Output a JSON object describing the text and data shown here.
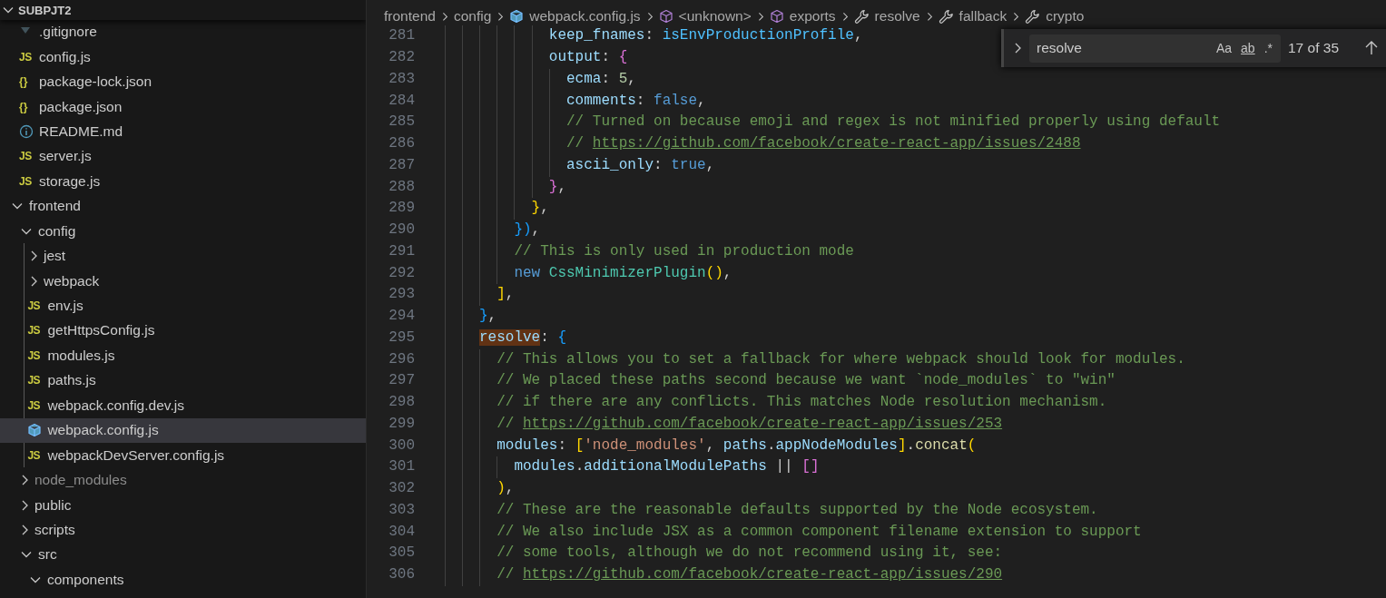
{
  "explorer": {
    "title": "SUBPJT2",
    "expanded": true,
    "items": [
      {
        "kind": "gitignore",
        "label": ".gitignore",
        "selected": false,
        "ignored": false
      },
      {
        "kind": "js",
        "icon": "JS",
        "label": "config.js",
        "selected": false,
        "ignored": false
      },
      {
        "kind": "json",
        "icon": "{}",
        "label": "package-lock.json",
        "selected": false,
        "ignored": false
      },
      {
        "kind": "json",
        "icon": "{}",
        "label": "package.json",
        "selected": false,
        "ignored": false
      },
      {
        "kind": "info",
        "label": "README.md",
        "selected": false,
        "ignored": false
      },
      {
        "kind": "js",
        "icon": "JS",
        "label": "server.js",
        "selected": false,
        "ignored": false
      },
      {
        "kind": "js",
        "icon": "JS",
        "label": "storage.js",
        "selected": false,
        "ignored": false
      },
      {
        "kind": "folder",
        "label": "frontend",
        "expanded": true,
        "selected": false,
        "ignored": false,
        "children": [
          {
            "kind": "folder",
            "label": "config",
            "expanded": true,
            "selected": false,
            "ignored": false,
            "children": [
              {
                "kind": "folder",
                "label": "jest",
                "expanded": false,
                "selected": false,
                "ignored": false
              },
              {
                "kind": "folder",
                "label": "webpack",
                "expanded": false,
                "selected": false,
                "ignored": false
              },
              {
                "kind": "js",
                "icon": "JS",
                "label": "env.js",
                "selected": false,
                "ignored": false
              },
              {
                "kind": "js",
                "icon": "JS",
                "label": "getHttpsConfig.js",
                "selected": false,
                "ignored": false
              },
              {
                "kind": "js",
                "icon": "JS",
                "label": "modules.js",
                "selected": false,
                "ignored": false
              },
              {
                "kind": "js",
                "icon": "JS",
                "label": "paths.js",
                "selected": false,
                "ignored": false
              },
              {
                "kind": "js",
                "icon": "JS",
                "label": "webpack.config.dev.js",
                "selected": false,
                "ignored": false
              },
              {
                "kind": "webpack",
                "label": "webpack.config.js",
                "selected": true,
                "ignored": false
              },
              {
                "kind": "js",
                "icon": "JS",
                "label": "webpackDevServer.config.js",
                "selected": false,
                "ignored": false
              }
            ]
          },
          {
            "kind": "folder",
            "label": "node_modules",
            "expanded": false,
            "selected": false,
            "ignored": true
          },
          {
            "kind": "folder",
            "label": "public",
            "expanded": false,
            "selected": false,
            "ignored": false
          },
          {
            "kind": "folder",
            "label": "scripts",
            "expanded": false,
            "selected": false,
            "ignored": false
          },
          {
            "kind": "folder",
            "label": "src",
            "expanded": true,
            "selected": false,
            "ignored": false,
            "children": [
              {
                "kind": "folder",
                "label": "components",
                "expanded": true,
                "selected": false,
                "ignored": false
              }
            ]
          }
        ]
      }
    ]
  },
  "breadcrumbs": [
    {
      "kind": "folder",
      "label": "frontend"
    },
    {
      "kind": "folder",
      "label": "config"
    },
    {
      "kind": "webpack",
      "label": "webpack.config.js"
    },
    {
      "kind": "module",
      "label": "<unknown>"
    },
    {
      "kind": "module",
      "label": "exports"
    },
    {
      "kind": "property",
      "label": "resolve"
    },
    {
      "kind": "property",
      "label": "fallback"
    },
    {
      "kind": "property",
      "label": "crypto"
    }
  ],
  "find": {
    "expanded": false,
    "value": "resolve",
    "options": [
      {
        "label": "Aa",
        "on": false
      },
      {
        "label": "ab",
        "on": false
      },
      {
        "label": ".*",
        "on": false
      }
    ],
    "count": "17 of 35"
  },
  "editor": {
    "lines": [
      {
        "number": "281",
        "tokens": [
          {
            "kind": "property",
            "text": "              keep_fnames"
          },
          {
            "kind": "punct",
            "text": ": "
          },
          {
            "kind": "constant",
            "text": "isEnvProductionProfile"
          },
          {
            "kind": "punct",
            "text": ","
          }
        ]
      },
      {
        "number": "282",
        "tokens": [
          {
            "kind": "property",
            "text": "              output"
          },
          {
            "kind": "punct",
            "text": ": "
          },
          {
            "kind": "bracket2",
            "text": "{"
          }
        ]
      },
      {
        "number": "283",
        "tokens": [
          {
            "kind": "property",
            "text": "                ecma"
          },
          {
            "kind": "punct",
            "text": ": "
          },
          {
            "kind": "number",
            "text": "5"
          },
          {
            "kind": "punct",
            "text": ","
          }
        ]
      },
      {
        "number": "284",
        "tokens": [
          {
            "kind": "property",
            "text": "                comments"
          },
          {
            "kind": "punct",
            "text": ": "
          },
          {
            "kind": "keyword",
            "text": "false"
          },
          {
            "kind": "punct",
            "text": ","
          }
        ]
      },
      {
        "number": "285",
        "tokens": [
          {
            "kind": "comment",
            "text": "                // Turned on because emoji and regex is not minified properly using default"
          }
        ]
      },
      {
        "number": "286",
        "tokens": [
          {
            "kind": "comment",
            "text": "                // "
          },
          {
            "kind": "link",
            "text": "https://github.com/facebook/create-react-app/issues/2488"
          }
        ]
      },
      {
        "number": "287",
        "tokens": [
          {
            "kind": "property",
            "text": "                ascii_only"
          },
          {
            "kind": "punct",
            "text": ": "
          },
          {
            "kind": "keyword",
            "text": "true"
          },
          {
            "kind": "punct",
            "text": ","
          }
        ]
      },
      {
        "number": "288",
        "tokens": [
          {
            "kind": "bracket2",
            "text": "              }"
          },
          {
            "kind": "punct",
            "text": ","
          }
        ]
      },
      {
        "number": "289",
        "tokens": [
          {
            "kind": "bracket1",
            "text": "            }"
          },
          {
            "kind": "punct",
            "text": ","
          }
        ]
      },
      {
        "number": "290",
        "tokens": [
          {
            "kind": "bracket3",
            "text": "          })"
          },
          {
            "kind": "punct",
            "text": ","
          }
        ]
      },
      {
        "number": "291",
        "tokens": [
          {
            "kind": "comment",
            "text": "          // This is only used in production mode"
          }
        ]
      },
      {
        "number": "292",
        "tokens": [
          {
            "kind": "keyword",
            "text": "          new "
          },
          {
            "kind": "class",
            "text": "CssMinimizerPlugin"
          },
          {
            "kind": "bracket1",
            "text": "()"
          },
          {
            "kind": "punct",
            "text": ","
          }
        ]
      },
      {
        "number": "293",
        "tokens": [
          {
            "kind": "bracket1",
            "text": "        ]"
          },
          {
            "kind": "punct",
            "text": ","
          }
        ]
      },
      {
        "number": "294",
        "tokens": [
          {
            "kind": "bracket3",
            "text": "      }"
          },
          {
            "kind": "punct",
            "text": ","
          }
        ]
      },
      {
        "number": "295",
        "tokens": [
          {
            "kind": "property",
            "text": "      resolve",
            "match": true
          },
          {
            "kind": "punct",
            "text": ": "
          },
          {
            "kind": "bracket3",
            "text": "{"
          }
        ]
      },
      {
        "number": "296",
        "tokens": [
          {
            "kind": "comment",
            "text": "        // This allows you to set a fallback for where webpack should look for modules."
          }
        ]
      },
      {
        "number": "297",
        "tokens": [
          {
            "kind": "comment",
            "text": "        // We placed these paths second because we want `node_modules` to \"win\""
          }
        ]
      },
      {
        "number": "298",
        "tokens": [
          {
            "kind": "comment",
            "text": "        // if there are any conflicts. This matches Node resolution mechanism."
          }
        ]
      },
      {
        "number": "299",
        "tokens": [
          {
            "kind": "comment",
            "text": "        // "
          },
          {
            "kind": "link",
            "text": "https://github.com/facebook/create-react-app/issues/253"
          }
        ]
      },
      {
        "number": "300",
        "tokens": [
          {
            "kind": "property",
            "text": "        modules"
          },
          {
            "kind": "punct",
            "text": ": "
          },
          {
            "kind": "bracket1",
            "text": "["
          },
          {
            "kind": "string",
            "text": "'node_modules'"
          },
          {
            "kind": "punct",
            "text": ", "
          },
          {
            "kind": "variable",
            "text": "paths"
          },
          {
            "kind": "punct",
            "text": "."
          },
          {
            "kind": "variable",
            "text": "appNodeModules"
          },
          {
            "kind": "bracket1",
            "text": "]"
          },
          {
            "kind": "punct",
            "text": "."
          },
          {
            "kind": "function",
            "text": "concat"
          },
          {
            "kind": "bracket1",
            "text": "("
          }
        ]
      },
      {
        "number": "301",
        "tokens": [
          {
            "kind": "variable",
            "text": "          modules"
          },
          {
            "kind": "punct",
            "text": "."
          },
          {
            "kind": "variable",
            "text": "additionalModulePaths"
          },
          {
            "kind": "punct",
            "text": " || "
          },
          {
            "kind": "bracket2",
            "text": "[]"
          }
        ]
      },
      {
        "number": "302",
        "tokens": [
          {
            "kind": "bracket1",
            "text": "        )"
          },
          {
            "kind": "punct",
            "text": ","
          }
        ]
      },
      {
        "number": "303",
        "tokens": [
          {
            "kind": "comment",
            "text": "        // These are the reasonable defaults supported by the Node ecosystem."
          }
        ]
      },
      {
        "number": "304",
        "tokens": [
          {
            "kind": "comment",
            "text": "        // We also include JSX as a common component filename extension to support"
          }
        ]
      },
      {
        "number": "305",
        "tokens": [
          {
            "kind": "comment",
            "text": "        // some tools, although we do not recommend using it, see:"
          }
        ]
      },
      {
        "number": "306",
        "tokens": [
          {
            "kind": "comment",
            "text": "        // "
          },
          {
            "kind": "link",
            "text": "https://github.com/facebook/create-react-app/issues/290"
          }
        ]
      }
    ]
  }
}
